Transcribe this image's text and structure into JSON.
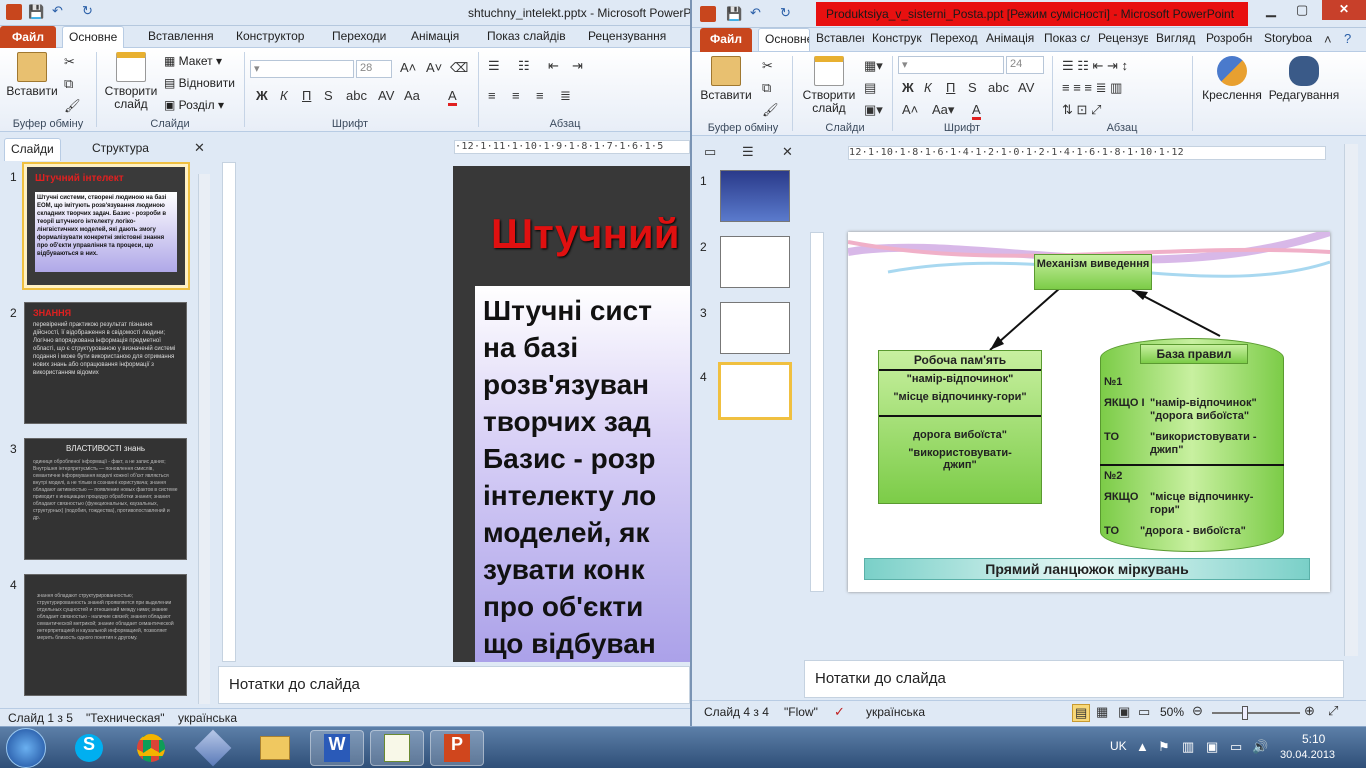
{
  "left_window": {
    "title": "shtuchny_intelekt.pptx - Microsoft PowerPoint",
    "file_tab": "Файл",
    "tabs": [
      "Основне",
      "Вставлення",
      "Конструктор",
      "Переходи",
      "Анімація",
      "Показ слайдів",
      "Рецензування"
    ],
    "ribbon": {
      "paste": "Вставити",
      "new_slide": "Створити слайд",
      "layout": "Макет",
      "reset": "Відновити",
      "section": "Розділ",
      "font_size": "28",
      "groups": [
        "Буфер обміну",
        "Слайди",
        "Шрифт",
        "Абзац"
      ]
    },
    "panel_tabs": [
      "Слайди",
      "Структура"
    ],
    "thumbs": [
      {
        "num": "1",
        "title": "Штучний інтелект",
        "body": "Штучні системи, створені людиною на базі ЕОМ, що імітують розв'язування людиною складних творчих задач. Базис - розроби в теорії штучного інтелекту логіко-лінгвістичних моделей, які дають змогу формалізувати конкретні змістовні знання про об'єкти управління та процеси, що відбуваються в них."
      },
      {
        "num": "2",
        "title": "ЗНАННЯ",
        "body": "перевірений практикою результат пізнання дійсності, її відображення в свідомості людини; Логічно впорядкована інформація предметної області, що є структурованою у визначеній системі подання і може бути використаною для отримання нових знань або опрацювання інформації з використанням відомих"
      },
      {
        "num": "3",
        "title": "ВЛАСТИВОСТІ знань",
        "body": "одиниця обробленої інформації - факт, а не запис даних; Внутрішня інтерпретуємість — поновлення смислів, семантичне інформування моделі кожної об'єкт являється внутрі моделі, а не тільки в сознанні користувача; знання обладают активностью — появление новых фактов в системе приводит к инициации процедур обработки знания; знания обладают связностью (функциональных, каузальных, структурных) (подобия, тождества), противопоставлений и др."
      },
      {
        "num": "4",
        "title": "",
        "body": "знання обладают структурированностью; структурированность знаний проявляется при выделении отдельных сущностей и отношений между ними; знание обладает связностью - наличие связей; знания обладают семантической метрикой; знание обладает семантической интерпретацией и каузальной информацией, позволяет мерить близость одного понятия к другому."
      }
    ],
    "slide": {
      "title": "Штучний",
      "lines": [
        "Штучні сист",
        "на   базі",
        "розв'язуван",
        "творчих зад",
        "Базис - розр",
        "інтелекту ло",
        "моделей, як",
        "зувати конк",
        "про об'єкти",
        "що відбуван"
      ]
    },
    "notes": "Нотатки до слайда",
    "status": [
      "Слайд 1 з 5",
      "\"Техническая\"",
      "українська"
    ]
  },
  "right_window": {
    "title": "Produktsiya_v_sisterni_Posta.ppt [Режим сумісності] - Microsoft PowerPoint",
    "file_tab": "Файл",
    "tabs": [
      "Основне",
      "Вставлен",
      "Конструк",
      "Переход",
      "Анімація",
      "Показ сл",
      "Рецензув",
      "Вигляд",
      "Розробн",
      "Storyboa"
    ],
    "ribbon": {
      "paste": "Вставити",
      "new_slide": "Створити слайд",
      "drawing": "Креслення",
      "editing": "Редагування",
      "font_size": "24",
      "groups": [
        "Буфер обміну",
        "Слайди",
        "Шрифт",
        "Абзац"
      ]
    },
    "thumb_nums": [
      "1",
      "2",
      "3",
      "4"
    ],
    "slide": {
      "mechanism": "Механізм виведення",
      "working_memory": "Робоча пам'ять",
      "wm_items": [
        "\"намір-відпочинок\"",
        "\"місце відпочинку-гори\"",
        "дорога вибоїста\"",
        "\"використовувати-джип\""
      ],
      "kb_title": "База правил",
      "rule1": {
        "num": "№1",
        "if": "ЯКЩО І",
        "if_text": "\"намір-відпочинок\" \"дорога вибоїста\"",
        "then": "ТО",
        "then_text": "\"використовувати - джип\""
      },
      "rule2": {
        "num": "№2",
        "if": "ЯКЩО",
        "if_text": "\"місце відпочинку-гори\"",
        "then": "ТО",
        "then_text": "\"дорога - вибоїста\""
      },
      "footer": "Прямий ланцюжок міркувань"
    },
    "notes": "Нотатки до слайда",
    "status": {
      "slide": "Слайд 4 з 4",
      "theme": "\"Flow\"",
      "lang": "українська",
      "zoom": "50%"
    }
  },
  "taskbar": {
    "lang": "UK",
    "time": "5:10",
    "date": "30.04.2013"
  },
  "colors": {
    "file_tab": "#c8461d",
    "title_red": "#e01010",
    "ribbon_bg": "#dfe9f5",
    "slide_green": "#7ccc48"
  }
}
